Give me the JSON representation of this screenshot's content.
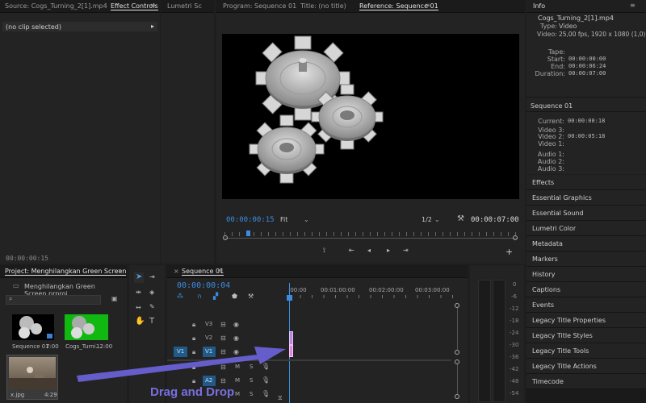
{
  "source_panel": {
    "tabs": [
      "Source: Cogs_Turning_2[1].mp4",
      "Effect Controls",
      "Lumetri Sc"
    ],
    "no_clip": "(no clip selected)",
    "timecode": "00:00:00:15"
  },
  "program_panel": {
    "tabs": [
      "Program: Sequence 01",
      "Title: (no title)",
      "Reference: Sequence 01"
    ],
    "timecode": "00:00:00:15",
    "fit": "Fit",
    "resolution": "1/2",
    "duration": "00:00:07:00"
  },
  "info_panel": {
    "title": "Info",
    "clip_name": "Cogs_Turning_2[1].mp4",
    "type_label": "Type:",
    "type_value": "Video",
    "video_label": "Video:",
    "video_value": "25,00 fps, 1920 x 1080 (1,0)",
    "tape_label": "Tape:",
    "start_label": "Start:",
    "start_value": "00:00:00:00",
    "end_label": "End:",
    "end_value": "00:00:06:24",
    "duration_label": "Duration:",
    "duration_value": "00:00:07:00",
    "sequence_name": "Sequence 01",
    "current_label": "Current:",
    "current_value": "00:00:00:18",
    "v3_label": "Video 3:",
    "v2_label": "Video 2:",
    "v2_value": "00:00:05:18",
    "v1_label": "Video 1:",
    "a1_label": "Audio 1:",
    "a2_label": "Audio 2:",
    "a3_label": "Audio 3:"
  },
  "right_panels": [
    "Effects",
    "Essential Graphics",
    "Essential Sound",
    "Lumetri Color",
    "Metadata",
    "Markers",
    "History",
    "Captions",
    "Events",
    "Legacy Title Properties",
    "Legacy Title Styles",
    "Legacy Title Tools",
    "Legacy Title Actions",
    "Timecode"
  ],
  "project_panel": {
    "tab": "Project: Menghilangkan Green Screen",
    "file": "Menghilangkan Green Screen.prproj",
    "items": [
      {
        "name": "Sequence 01",
        "dur": "7:00"
      },
      {
        "name": "Cogs_Turni...",
        "dur": "12:00"
      },
      {
        "name": "x.jpg",
        "dur": "4:29"
      }
    ]
  },
  "timeline": {
    "tab": "Sequence 01",
    "timecode": "00:00:00:04",
    "ruler": [
      ":00:00",
      "00:01:00:00",
      "00:02:00:00",
      "00:03:00:00"
    ],
    "tracks": {
      "v3": "V3",
      "v2": "V2",
      "v1": "V1",
      "src_v1": "V1",
      "a2": "A2",
      "m": "M",
      "s": "S"
    }
  },
  "meter_labels": [
    "0",
    "-6",
    "-12",
    "-18",
    "-24",
    "-30",
    "-36",
    "-42",
    "-48",
    "-54"
  ],
  "overlay": {
    "caption": "Drag and Drop"
  },
  "colors": {
    "accent": "#3b8de0",
    "arrow": "#6b63d8",
    "caption": "#7a6fe0",
    "clip": "#d78ad7"
  }
}
